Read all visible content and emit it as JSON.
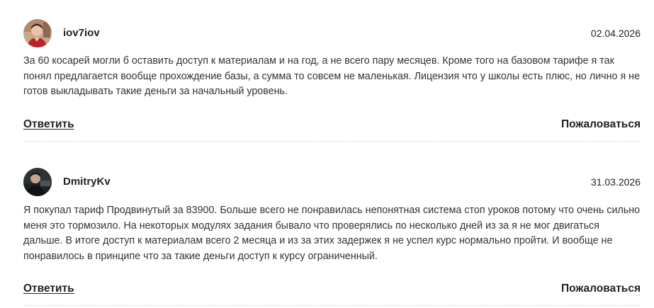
{
  "comments": [
    {
      "username": "iov7iov",
      "date": "02.04.2026",
      "avatar_icon": "user-avatar-photo",
      "text": "За 60 косарей могли б оставить доступ к материалам и на год, а не всего пару месяцев. Кроме того на базовом тарифе я так понял предлагается вообще прохождение базы, а сумма то совсем не маленькая. Лицензия что у школы есть плюс, но лично я не готов выкладывать такие деньги за начальный уровень.",
      "reply_label": "Ответить",
      "report_label": "Пожаловаться"
    },
    {
      "username": "DmitryKv",
      "date": "31.03.2026",
      "avatar_icon": "user-avatar-photo",
      "text": "Я покупал тариф Продвинутый за 83900. Больше всего не понравилась непонятная система стоп уроков потому что очень сильно меня это тормозило. На некоторых модулях задания бывало что проверялись по несколько дней из за я не мог двигаться дальше. В итоге доступ к материалам всего 2 месяца и из за этих задержек я не успел курс нормально пройти. И вообще не понравилось в принципе что за такие деньги доступ к курсу ограниченный.",
      "reply_label": "Ответить",
      "report_label": "Пожаловаться"
    }
  ],
  "colors": {
    "text": "#333333",
    "heading": "#222222",
    "divider": "#d6d6d6",
    "background": "#ffffff"
  }
}
